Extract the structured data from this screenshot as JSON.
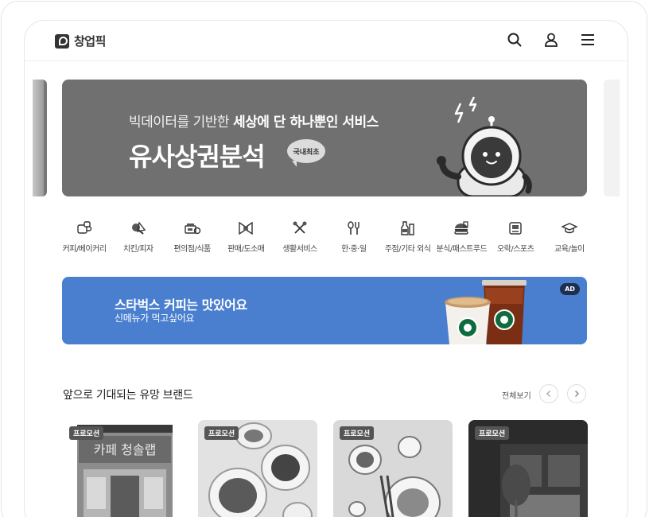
{
  "app": {
    "logo_text": "창업픽"
  },
  "header": {
    "icons": [
      "search-icon",
      "user-icon",
      "menu-icon"
    ]
  },
  "hero": {
    "subtitle_prefix": "빅데이터를 기반한 ",
    "subtitle_bold": "세상에 단 하나뿐인 서비스",
    "title": "유사상권분석",
    "badge": "국내최초",
    "bg_color": "#707070"
  },
  "categories": [
    {
      "label": "커피/베이커리",
      "icon": "coffee-icon"
    },
    {
      "label": "치킨/피자",
      "icon": "chicken-icon"
    },
    {
      "label": "편의점/식품",
      "icon": "store-icon"
    },
    {
      "label": "판매/도소매",
      "icon": "ribbon-icon"
    },
    {
      "label": "생활서비스",
      "icon": "tools-icon"
    },
    {
      "label": "한·중·일",
      "icon": "utensils-icon"
    },
    {
      "label": "주점/기타 외식",
      "icon": "bottle-icon"
    },
    {
      "label": "분식/패스트푸드",
      "icon": "burger-icon"
    },
    {
      "label": "오락/스포츠",
      "icon": "game-icon"
    },
    {
      "label": "교육/놀이",
      "icon": "graduation-cap-icon"
    }
  ],
  "ad": {
    "title": "스타벅스 커피는 맛있어요",
    "subtitle": "신메뉴가 먹고싶어요",
    "badge": "AD",
    "bg_color": "#4a7fd0"
  },
  "section": {
    "title": "앞으로 기대되는 유망 브랜드",
    "view_all": "전체보기"
  },
  "brands": [
    {
      "tag": "프로모션"
    },
    {
      "tag": "프로모션"
    },
    {
      "tag": "프로모션"
    },
    {
      "tag": "프로모션"
    }
  ]
}
